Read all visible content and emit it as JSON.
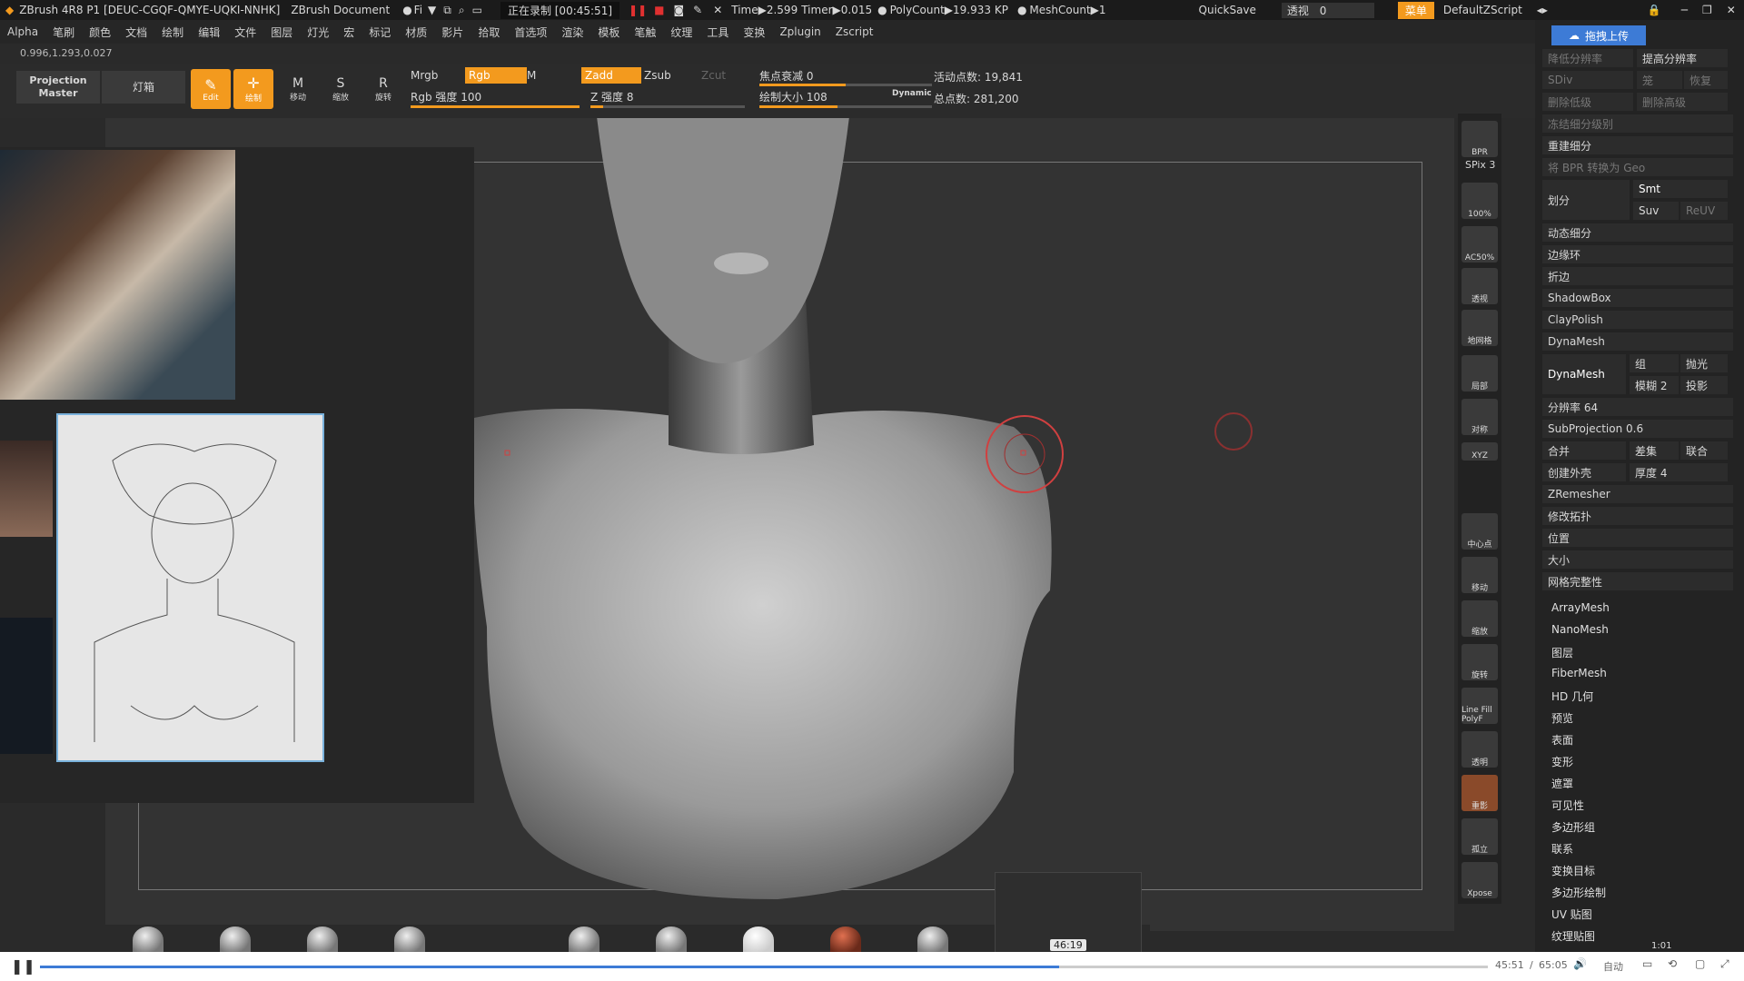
{
  "title_bar": {
    "app_title": "ZBrush 4R8 P1 [DEUC-CGQF-QMYE-UQKI-NNHK]",
    "document": "ZBrush Document",
    "file_short": "Fi",
    "recording": "正在录制 [00:45:51]",
    "time": "Time▶2.599",
    "timer": "Timer▶0.015",
    "polycount": "PolyCount▶19.933 KP",
    "meshcount": "MeshCount▶1",
    "quicksave": "QuickSave",
    "perspective_label": "透视",
    "perspective_value": "0",
    "menu_button": "菜单",
    "default_script": "DefaultZScript"
  },
  "menu_bar": [
    "Alpha",
    "笔刷",
    "颜色",
    "文档",
    "绘制",
    "编辑",
    "文件",
    "图层",
    "灯光",
    "宏",
    "标记",
    "材质",
    "影片",
    "拾取",
    "首选项",
    "渲染",
    "模板",
    "笔触",
    "纹理",
    "工具",
    "变换",
    "Zplugin",
    "Zscript"
  ],
  "coordinates": "0.996,1.293,0.027",
  "toolbar": {
    "projection_master": "Projection Master",
    "lightbox": "灯箱",
    "edit": "Edit",
    "draw": "绘制",
    "move": "移动",
    "scale": "缩放",
    "rotate": "旋转",
    "mrgb": "Mrgb",
    "rgb": "Rgb",
    "m": "M",
    "zadd": "Zadd",
    "zsub": "Zsub",
    "zcut": "Zcut",
    "rgb_intensity": "Rgb 强度 100",
    "z_intensity": "Z 强度 8",
    "focal_shift": "焦点衰减 0",
    "draw_size": "绘制大小 108",
    "dynamic": "Dynamic",
    "active_points": "活动点数: 19,841",
    "total_points": "总点数: 281,200"
  },
  "right_panel": {
    "upload": "拖拽上传",
    "lower_res": "降低分辨率",
    "higher_res": "提高分辨率",
    "sdiv": "SDiv",
    "cage": "笼",
    "restore": "恢复",
    "del_lower": "删除低级",
    "del_higher": "删除高级",
    "freeze_sub": "冻结细分级别",
    "rebuild_sub": "重建细分",
    "bpr_geo": "将 BPR 转换为 Geo",
    "divide": "划分",
    "smt": "Smt",
    "suv": "Suv",
    "reuv": "ReUV",
    "dynamic_sub": "动态细分",
    "edgeloop": "边缘环",
    "crease": "折边",
    "shadowbox": "ShadowBox",
    "claypolish": "ClayPolish",
    "dynamesh_header": "DynaMesh",
    "dynamesh_btn": "DynaMesh",
    "group": "组",
    "polish": "抛光",
    "blur": "模糊 2",
    "project": "投影",
    "resolution": "分辨率 64",
    "subprojection": "SubProjection 0.6",
    "add": "合并",
    "sub": "差集",
    "union": "联合",
    "create_shell": "创建外壳",
    "thickness": "厚度 4",
    "zremesher": "ZRemesher",
    "modify_topo": "修改拓扑",
    "position": "位置",
    "size": "大小",
    "mesh_integrity": "网格完整性",
    "subpalettes": [
      "ArrayMesh",
      "NanoMesh",
      "图层",
      "FiberMesh",
      "HD 几何",
      "预览",
      "表面",
      "变形",
      "遮罩",
      "可见性",
      "多边形组",
      "联系",
      "变换目标",
      "多边形绘制",
      "UV 贴图",
      "纹理贴图"
    ]
  },
  "right_shelf": {
    "bpr": "BPR",
    "spix": "SPix 3",
    "zoom100": "100%",
    "ac50": "AC50%",
    "persp": "透视",
    "floor": "地网格",
    "local": "局部",
    "sym": "对称",
    "xyz": "XYZ",
    "frame": "中心点",
    "move": "移动",
    "zoom": "缩放",
    "rotate": "旋转",
    "polyf": "Line Fill PolyF",
    "transp": "透明",
    "ghost": "重影",
    "solo": "孤立",
    "xpose": "Xpose"
  },
  "thumbnail_time": "46:19",
  "player": {
    "current": "45:51",
    "total": "65:05",
    "separator": "/",
    "auto": "自动",
    "progress": 0.704,
    "small_time": "1:01"
  }
}
